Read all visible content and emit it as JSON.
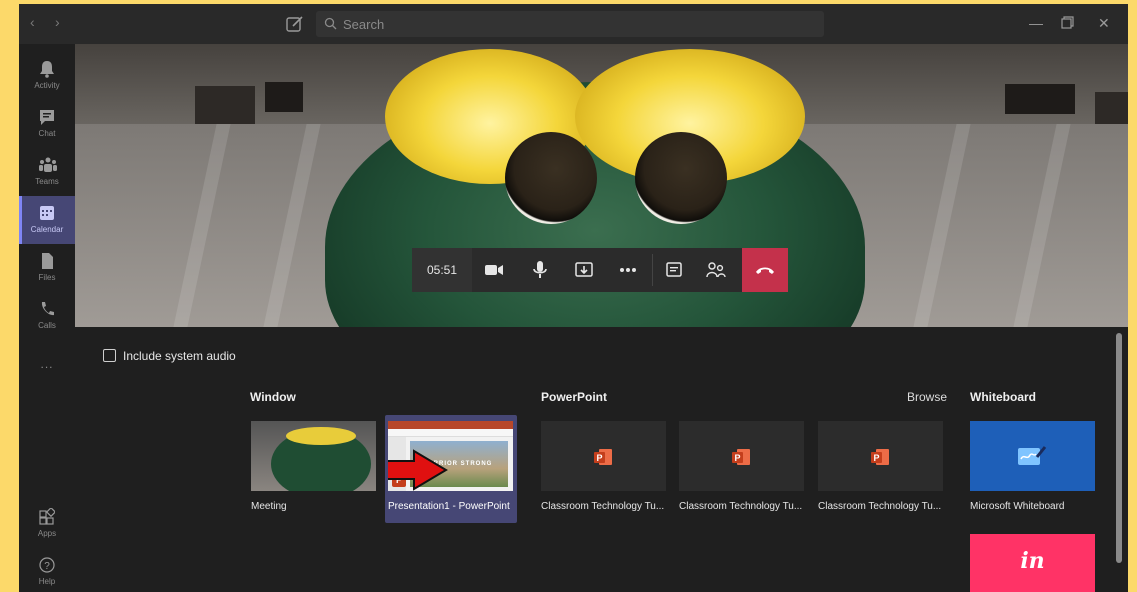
{
  "titlebar": {
    "back_icon": "chevron-left-icon",
    "forward_icon": "chevron-right-icon",
    "compose_icon": "compose-icon",
    "search_placeholder": "Search",
    "window_controls": [
      "minimize-icon",
      "restore-icon",
      "close-icon"
    ]
  },
  "rail": {
    "items": [
      {
        "label": "Activity",
        "icon": "bell-icon"
      },
      {
        "label": "Chat",
        "icon": "chat-icon"
      },
      {
        "label": "Teams",
        "icon": "teams-icon"
      },
      {
        "label": "Calendar",
        "icon": "calendar-icon",
        "active": true
      },
      {
        "label": "Files",
        "icon": "file-icon"
      },
      {
        "label": "Calls",
        "icon": "phone-icon"
      }
    ],
    "more": "...",
    "bottom": [
      {
        "label": "Apps",
        "icon": "apps-icon"
      },
      {
        "label": "Help",
        "icon": "help-icon"
      }
    ]
  },
  "call": {
    "timer": "05:51",
    "controls": [
      "camera-icon",
      "mic-icon",
      "share-tray-icon",
      "more-icon",
      "chat-icon",
      "participants-icon",
      "hangup-icon"
    ],
    "colors": {
      "hangup": "#c4314b",
      "accent": "#464775"
    }
  },
  "share": {
    "include_audio": "Include system audio",
    "window": {
      "title": "Window",
      "items": [
        {
          "caption": "Meeting"
        },
        {
          "caption": "Presentation1 - PowerPoint",
          "selected": true,
          "slide_text": "WARRIOR STRONG",
          "badge": "P"
        }
      ]
    },
    "powerpoint": {
      "title": "PowerPoint",
      "browse": "Browse",
      "items": [
        {
          "caption": "Classroom Technology Tu..."
        },
        {
          "caption": "Classroom Technology Tu..."
        },
        {
          "caption": "Classroom Technology Tu..."
        }
      ]
    },
    "whiteboard": {
      "title": "Whiteboard",
      "items": [
        {
          "caption": "Microsoft Whiteboard",
          "color": "#1e5fb8"
        },
        {
          "caption": "",
          "logo": "in",
          "color": "#ff3366"
        }
      ]
    }
  }
}
